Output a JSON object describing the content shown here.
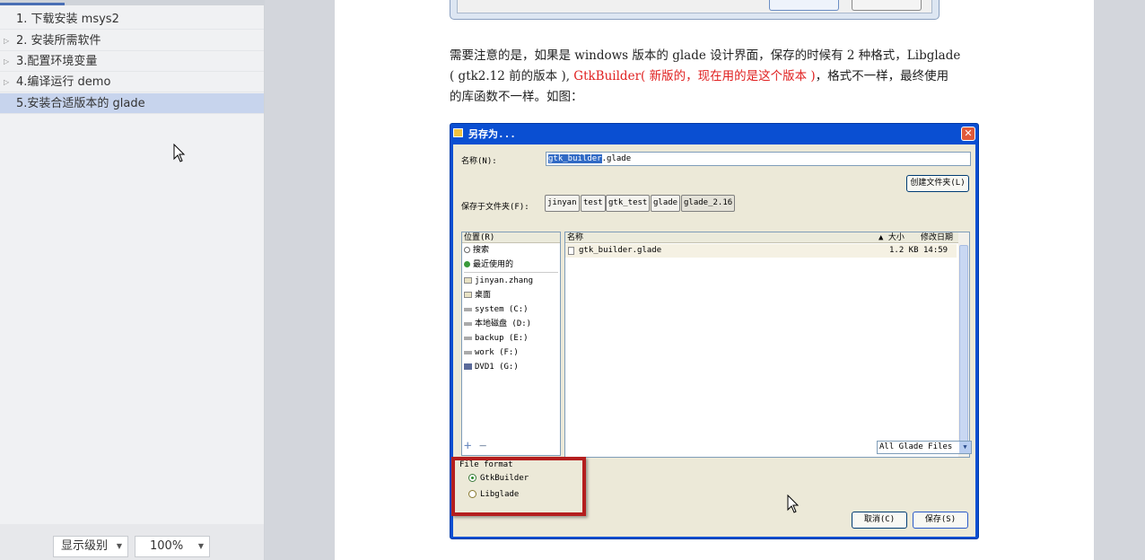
{
  "sidebar": {
    "items": [
      {
        "label": "1. 下载安装 msys2",
        "expandable": false,
        "selected": false
      },
      {
        "label": "2. 安装所需软件",
        "expandable": true,
        "selected": false
      },
      {
        "label": "3.配置环境变量",
        "expandable": true,
        "selected": false
      },
      {
        "label": "4.编译运行 demo",
        "expandable": true,
        "selected": false
      },
      {
        "label": "5.安装合适版本的 glade",
        "expandable": false,
        "selected": true
      }
    ],
    "level_select": "显示级别",
    "zoom_select": "100%"
  },
  "document": {
    "para1_a": "需要注意的是，如果是 windows 版本的 glade 设计界面，保存的时候有 2 种格式，Libglade",
    "para2_a": "( gtk2.12 前的版本 ), ",
    "para2_red": "GtkBuilder( 新版的，现在用的是这个版本 )",
    "para2_b": "，格式不一样，最终使用",
    "para3": "的库函数不一样。如图："
  },
  "save_dialog": {
    "title": "另存为...",
    "name_label": "名称(N):",
    "name_value_hl": "gtk_builder",
    "name_value_rest": ".glade",
    "folder_label": "保存于文件夹(F):",
    "crumbs": [
      "jinyan",
      "test",
      "gtk_test",
      "glade",
      "glade_2.16"
    ],
    "create_folder": "创建文件夹(L)",
    "places_header": "位置(R)",
    "places": [
      {
        "label": "搜索",
        "icon": "search-icon"
      },
      {
        "label": "最近使用的",
        "icon": "recent-icon"
      },
      {
        "label": "jinyan.zhang",
        "icon": "folder-icon"
      },
      {
        "label": "桌面",
        "icon": "folder-icon"
      },
      {
        "label": "system (C:)",
        "icon": "drive-icon"
      },
      {
        "label": "本地磁盘 (D:)",
        "icon": "drive-icon"
      },
      {
        "label": "backup (E:)",
        "icon": "drive-icon"
      },
      {
        "label": "work (F:)",
        "icon": "drive-icon"
      },
      {
        "label": "DVD1 (G:)",
        "icon": "dvd-icon"
      }
    ],
    "col_name": "名称",
    "col_size": "▲ 大小",
    "col_date": "修改日期",
    "file": {
      "name": "gtk_builder.glade",
      "size": "1.2 KB",
      "date": "14:59"
    },
    "add": "+",
    "remove": "−",
    "filter": "All Glade Files",
    "format_label": "File format",
    "format_gtkbuilder": "GtkBuilder",
    "format_libglade": "Libglade",
    "cancel": "取消(C)",
    "save": "保存(S)"
  },
  "colors": {
    "accent": "#4a6fb5",
    "selected": "#c7d4ed",
    "red_text": "#e02020",
    "red_box": "#b41e1e",
    "dialog_title": "#0a4fd2"
  }
}
